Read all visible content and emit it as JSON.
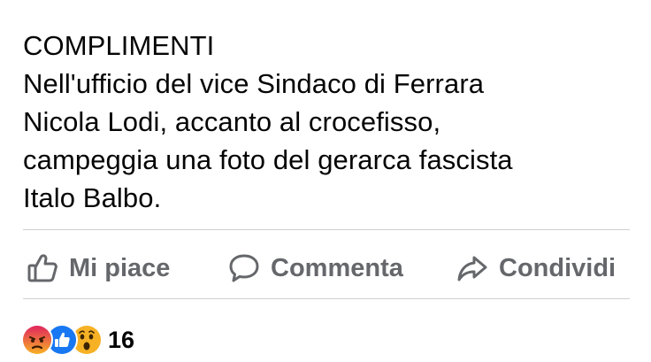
{
  "post": {
    "lines": [
      "COMPLIMENTI",
      "Nell'ufficio del vice Sindaco di Ferrara",
      "Nicola Lodi, accanto al crocefisso,",
      "campeggia una foto del gerarca fascista",
      "Italo Balbo."
    ]
  },
  "actions": {
    "like": {
      "label": "Mi piace",
      "icon": "thumbs-up-icon"
    },
    "comment": {
      "label": "Commenta",
      "icon": "speech-bubble-icon"
    },
    "share": {
      "label": "Condividi",
      "icon": "share-arrow-icon"
    }
  },
  "reactions": {
    "icons": [
      "angry-reaction-icon",
      "like-reaction-icon",
      "wow-reaction-icon"
    ],
    "count": "16"
  },
  "colors": {
    "text": "#050505",
    "secondary": "#65676b",
    "divider": "#ced0d4",
    "like_blue": "#1877f2",
    "angry": "#e9710f",
    "wow": "#f7b125"
  }
}
